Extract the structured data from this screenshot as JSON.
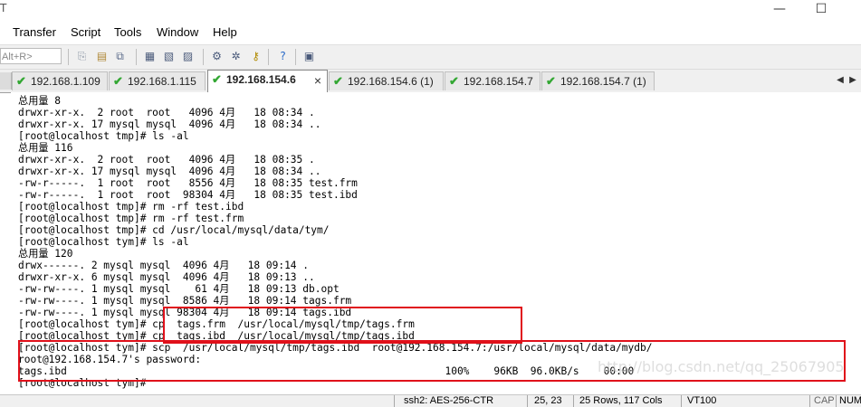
{
  "app": {
    "title_fragment": "T"
  },
  "window_controls": {
    "minimize": "—",
    "maximize": "☐"
  },
  "menu": {
    "items": [
      "Transfer",
      "Script",
      "Tools",
      "Window",
      "Help"
    ]
  },
  "toolbar": {
    "quick_connect_placeholder": "Alt+R>",
    "icons": [
      "copy-icon",
      "paste-icon",
      "copy-paste-icon",
      "find-icon",
      "print-setup-icon",
      "print-icon",
      "settings-icon",
      "sftp-icon",
      "key-icon",
      "help-icon",
      "map-icon"
    ]
  },
  "tabs": [
    {
      "label": "192.168.1.109",
      "status": "connected",
      "active": false
    },
    {
      "label": "192.168.1.115",
      "status": "connected",
      "active": false
    },
    {
      "label": "192.168.154.6",
      "status": "connected",
      "active": true,
      "close": "×"
    },
    {
      "label": "192.168.154.6 (1)",
      "status": "connected",
      "active": false
    },
    {
      "label": "192.168.154.7",
      "status": "connected",
      "active": false
    },
    {
      "label": "192.168.154.7 (1)",
      "status": "connected",
      "active": false
    }
  ],
  "tab_scroll": {
    "left": "◀",
    "right": "▶"
  },
  "terminal": {
    "lines": [
      "总用量 8",
      "drwxr-xr-x.  2 root  root   4096 4月   18 08:34 .",
      "drwxr-xr-x. 17 mysql mysql  4096 4月   18 08:34 ..",
      "[root@localhost tmp]# ls -al",
      "总用量 116",
      "drwxr-xr-x.  2 root  root   4096 4月   18 08:35 .",
      "drwxr-xr-x. 17 mysql mysql  4096 4月   18 08:34 ..",
      "-rw-r-----.  1 root  root   8556 4月   18 08:35 test.frm",
      "-rw-r-----.  1 root  root  98304 4月   18 08:35 test.ibd",
      "[root@localhost tmp]# rm -rf test.ibd",
      "[root@localhost tmp]# rm -rf test.frm",
      "[root@localhost tmp]# cd /usr/local/mysql/data/tym/",
      "[root@localhost tym]# ls -al",
      "总用量 120",
      "drwx------. 2 mysql mysql  4096 4月   18 09:14 .",
      "drwxr-xr-x. 6 mysql mysql  4096 4月   18 09:13 ..",
      "-rw-rw----. 1 mysql mysql    61 4月   18 09:13 db.opt",
      "-rw-rw----. 1 mysql mysql  8586 4月   18 09:14 tags.frm",
      "-rw-rw----. 1 mysql mysql 98304 4月   18 09:14 tags.ibd",
      "[root@localhost tym]# cp  tags.frm  /usr/local/mysql/tmp/tags.frm",
      "[root@localhost tym]# cp  tags.ibd  /usr/local/mysql/tmp/tags.ibd",
      "[root@localhost tym]# scp  /usr/local/mysql/tmp/tags.ibd  root@192.168.154.7:/usr/local/mysql/data/mydb/",
      "root@192.168.154.7's password:",
      "tags.ibd                                                              100%    96KB  96.0KB/s    00:00",
      "[root@localhost tym]#"
    ]
  },
  "annotations": {
    "highlight_color": "#e0101a"
  },
  "statusbar": {
    "cipher": "ssh2: AES-256-CTR",
    "cursor": "25,  23",
    "size": "25 Rows, 117 Cols",
    "terminal_type": "VT100",
    "cap": "CAP",
    "num": "NUM"
  },
  "watermark": "http://blog.csdn.net/qq_25067905"
}
